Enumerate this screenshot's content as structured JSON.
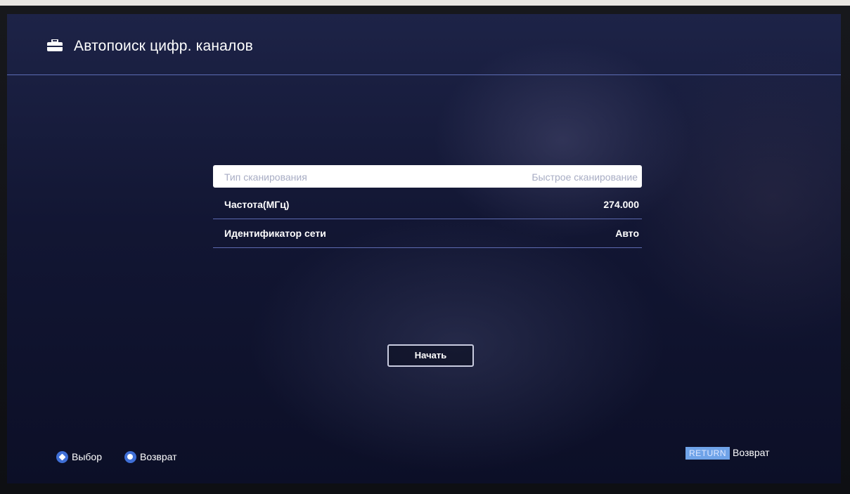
{
  "header": {
    "title": "Автопоиск цифр. каналов",
    "icon": "toolbox-icon"
  },
  "settings": [
    {
      "label": "Тип сканирования",
      "value": "Быстрое сканирование",
      "selected": true
    },
    {
      "label": "Частота(МГц)",
      "value": "274.000",
      "selected": false
    },
    {
      "label": "Идентификатор сети",
      "value": "Авто",
      "selected": false
    }
  ],
  "start_button": {
    "label": "Начать"
  },
  "footer": {
    "select_hint": "Выбор",
    "back_hint": "Возврат",
    "return_key": "RETURN",
    "return_label": "Возврат"
  },
  "colors": {
    "accent": "#3f6fd6",
    "divider": "#5d6db5",
    "return_key_bg": "#6fa3e8"
  }
}
